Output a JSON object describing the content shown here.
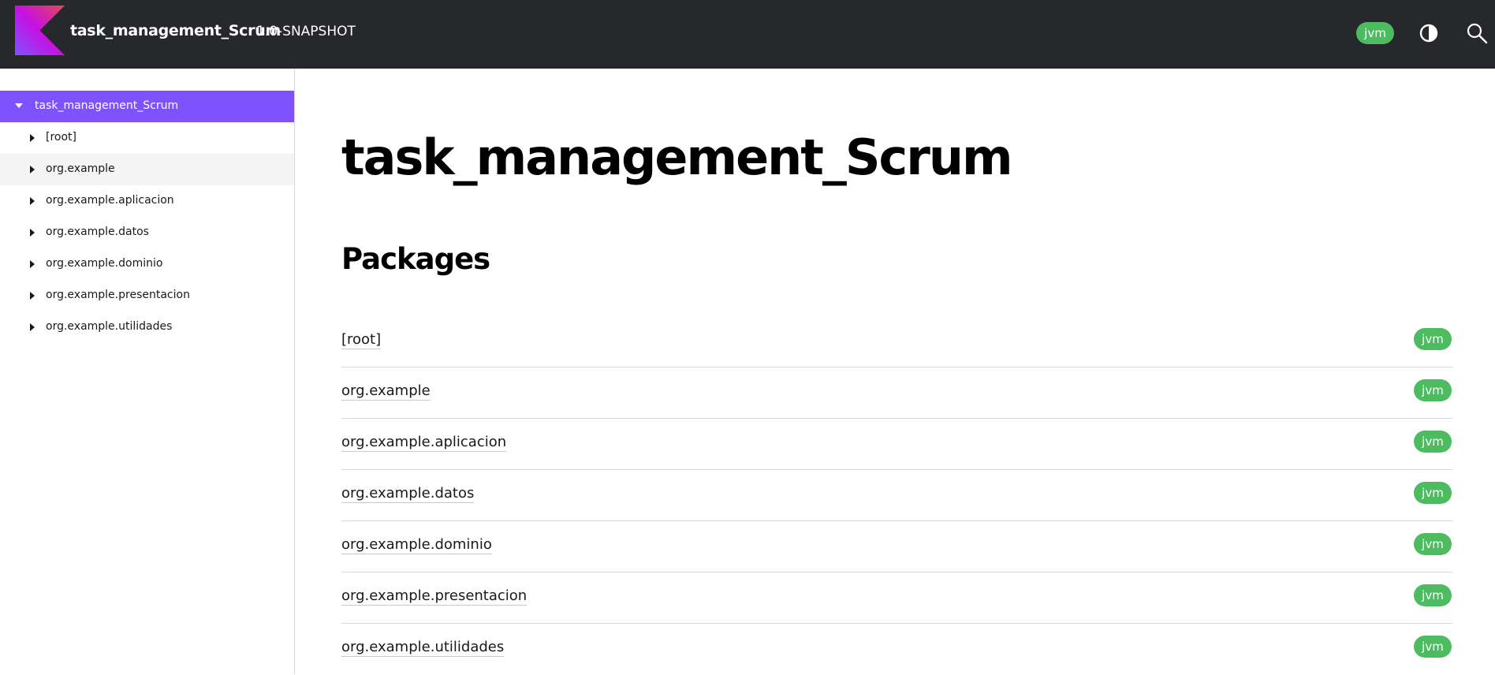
{
  "header": {
    "project_name": "task_management_Scrum",
    "version": "1.0-SNAPSHOT",
    "platform_filter": "jvm",
    "logo_icon": "kotlin-logo",
    "theme_icon": "contrast-icon",
    "search_icon": "search-icon"
  },
  "sidebar": {
    "root_label": "task_management_Scrum",
    "items": [
      {
        "label": "[root]"
      },
      {
        "label": "org.example"
      },
      {
        "label": "org.example.aplicacion"
      },
      {
        "label": "org.example.datos"
      },
      {
        "label": "org.example.dominio"
      },
      {
        "label": "org.example.presentacion"
      },
      {
        "label": "org.example.utilidades"
      }
    ]
  },
  "main": {
    "title": "task_management_Scrum",
    "section_title": "Packages",
    "packages": [
      {
        "name": "[root]",
        "platform": "jvm"
      },
      {
        "name": "org.example",
        "platform": "jvm"
      },
      {
        "name": "org.example.aplicacion",
        "platform": "jvm"
      },
      {
        "name": "org.example.datos",
        "platform": "jvm"
      },
      {
        "name": "org.example.dominio",
        "platform": "jvm"
      },
      {
        "name": "org.example.presentacion",
        "platform": "jvm"
      },
      {
        "name": "org.example.utilidades",
        "platform": "jvm"
      }
    ]
  },
  "colors": {
    "header_bg": "#27282c",
    "accent": "#7f52ff",
    "platform_jvm": "#4dbb5f"
  }
}
